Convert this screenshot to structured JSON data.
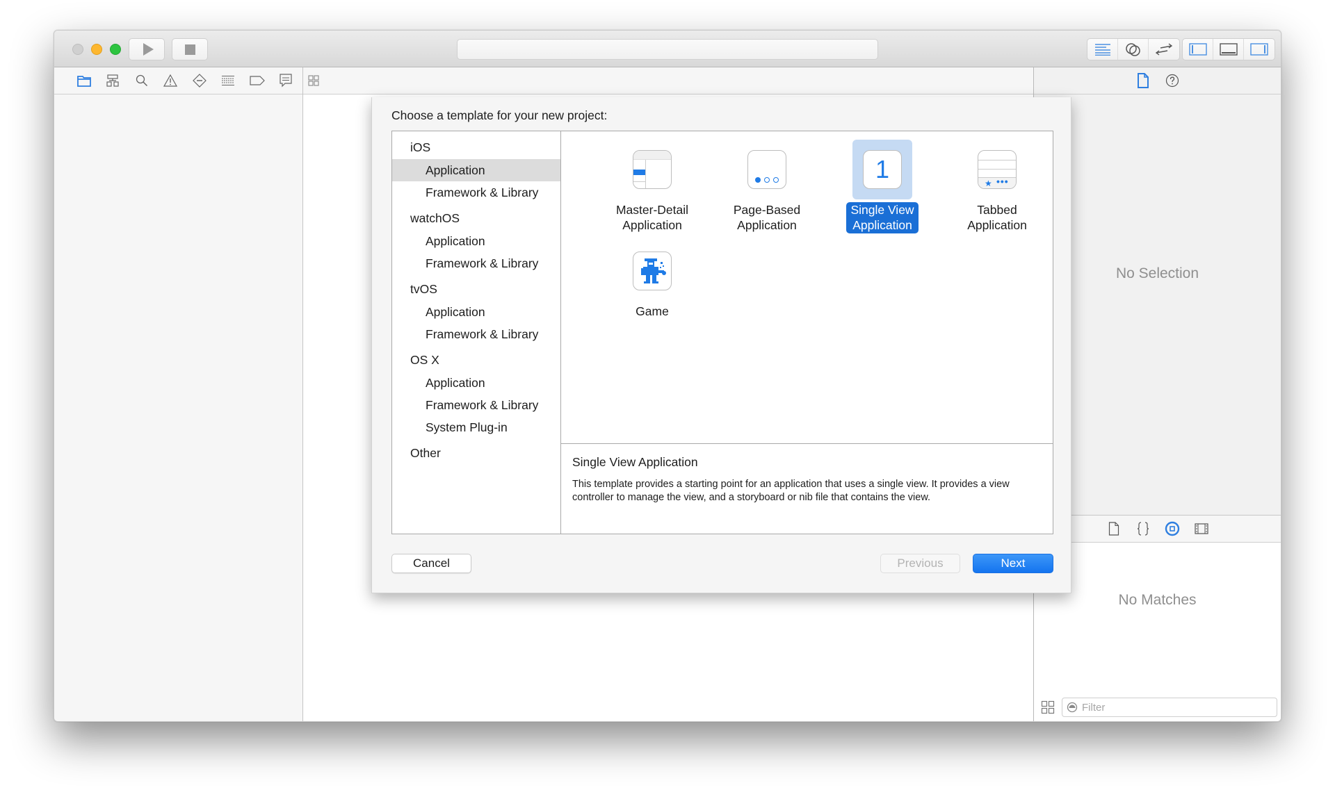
{
  "window": {
    "toolbar": {
      "run_button": {
        "icon": "play-icon"
      },
      "stop_button": {
        "icon": "stop-icon"
      },
      "activity_text": "",
      "editor_modes": [
        {
          "name": "standard-editor",
          "icon": "lines-icon",
          "active": true
        },
        {
          "name": "assistant-editor",
          "icon": "venn-circles-icon",
          "active": false
        },
        {
          "name": "version-editor",
          "icon": "arrows-swap-icon",
          "active": false
        }
      ],
      "view_toggles": [
        {
          "name": "navigator-toggle",
          "icon": "left-panel-icon",
          "active": true
        },
        {
          "name": "debug-toggle",
          "icon": "bottom-panel-icon",
          "active": false
        },
        {
          "name": "utilities-toggle",
          "icon": "right-panel-icon",
          "active": true
        }
      ]
    },
    "navigator_tabs": [
      {
        "name": "project-navigator",
        "icon": "folder-icon",
        "active": true
      },
      {
        "name": "symbol-navigator",
        "icon": "hierarchy-icon",
        "active": false
      },
      {
        "name": "find-navigator",
        "icon": "search-icon",
        "active": false
      },
      {
        "name": "issue-navigator",
        "icon": "warning-icon",
        "active": false
      },
      {
        "name": "test-navigator",
        "icon": "diamond-minus-icon",
        "active": false
      },
      {
        "name": "debug-navigator",
        "icon": "list-grid-icon",
        "active": false
      },
      {
        "name": "breakpoint-navigator",
        "icon": "breakpoint-tag-icon",
        "active": false
      },
      {
        "name": "report-navigator",
        "icon": "speech-bubble-icon",
        "active": false
      }
    ],
    "inspector": {
      "tabs": [
        {
          "name": "file-inspector",
          "icon": "document-icon",
          "active": true
        },
        {
          "name": "quick-help",
          "icon": "question-circle-icon",
          "active": false
        }
      ],
      "empty_text": "No Selection",
      "library_tabs": [
        {
          "name": "file-template-library",
          "icon": "document-icon",
          "active": false
        },
        {
          "name": "code-snippet-library",
          "icon": "braces-icon",
          "active": false
        },
        {
          "name": "object-library",
          "icon": "circle-square-icon",
          "active": true
        },
        {
          "name": "media-library",
          "icon": "film-icon",
          "active": false
        }
      ],
      "library_empty_text": "No Matches",
      "filter": {
        "placeholder": "Filter",
        "value": ""
      }
    }
  },
  "dialog": {
    "title": "Choose a template for your new project:",
    "categories": [
      {
        "group": "iOS",
        "items": [
          {
            "label": "Application",
            "selected": true
          },
          {
            "label": "Framework & Library",
            "selected": false
          }
        ]
      },
      {
        "group": "watchOS",
        "items": [
          {
            "label": "Application",
            "selected": false
          },
          {
            "label": "Framework & Library",
            "selected": false
          }
        ]
      },
      {
        "group": "tvOS",
        "items": [
          {
            "label": "Application",
            "selected": false
          },
          {
            "label": "Framework & Library",
            "selected": false
          }
        ]
      },
      {
        "group": "OS X",
        "items": [
          {
            "label": "Application",
            "selected": false
          },
          {
            "label": "Framework & Library",
            "selected": false
          },
          {
            "label": "System Plug-in",
            "selected": false
          }
        ]
      },
      {
        "group": "Other",
        "items": []
      }
    ],
    "templates": [
      {
        "line1": "Master-Detail",
        "line2": "Application",
        "icon": "master-detail-icon",
        "selected": false
      },
      {
        "line1": "Page-Based",
        "line2": "Application",
        "icon": "page-dots-icon",
        "selected": false
      },
      {
        "line1": "Single View",
        "line2": "Application",
        "icon": "single-view-icon",
        "icon_text": "1",
        "selected": true
      },
      {
        "line1": "Tabbed",
        "line2": "Application",
        "icon": "tab-bar-icon",
        "selected": false
      },
      {
        "line1": "Game",
        "line2": "",
        "icon": "game-robot-icon",
        "selected": false
      }
    ],
    "description": {
      "title": "Single View Application",
      "body": "This template provides a starting point for an application that uses a single view. It provides a view controller to manage the view, and a storyboard or nib file that contains the view."
    },
    "buttons": {
      "cancel": "Cancel",
      "previous": "Previous",
      "next": "Next"
    }
  },
  "colors": {
    "accent": "#1a6fd6",
    "selection_bg": "#c5daf3",
    "list_selection": "#dcdcdc",
    "muted_text": "#8f8f8f"
  }
}
